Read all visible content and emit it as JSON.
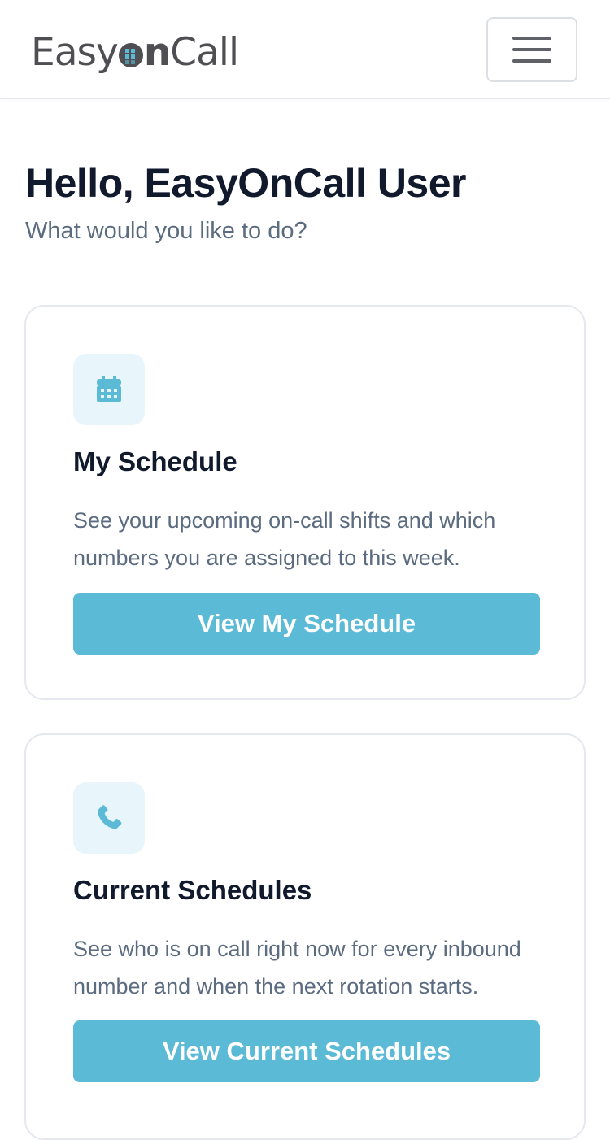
{
  "header": {
    "logo_prefix": "Easy",
    "logo_bold": "n",
    "logo_suffix": "Call",
    "logo_text": "EasyOnCall",
    "menu_icon": "hamburger-menu-icon"
  },
  "main": {
    "greeting": "Hello, EasyOnCall User",
    "subtitle": "What would you like to do?"
  },
  "cards": [
    {
      "icon": "calendar-icon",
      "title": "My Schedule",
      "description": "See your upcoming on-call shifts and which numbers you are assigned to this week.",
      "button_label": "View My Schedule"
    },
    {
      "icon": "phone-icon",
      "title": "Current Schedules",
      "description": "See who is on call right now for every inbound number and when the next rotation starts.",
      "button_label": "View Current Schedules"
    }
  ],
  "colors": {
    "accent": "#5bbad6",
    "icon_bg": "#e8f5fa",
    "title_text": "#111a2c",
    "muted_text": "#5b6b80",
    "logo": "#4f4f53"
  }
}
